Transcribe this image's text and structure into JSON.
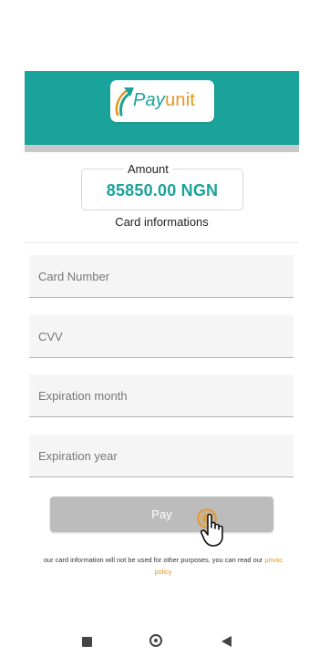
{
  "brand": {
    "logo_pay": "Pay",
    "logo_unit": "unit",
    "primary_color": "#1aa39a",
    "accent_color": "#e8951b"
  },
  "amount": {
    "label": "Amount",
    "value": "85850.00 NGN"
  },
  "card_form": {
    "title": "Card informations",
    "card_number_placeholder": "Card Number",
    "cvv_placeholder": "CVV",
    "expiration_month_placeholder": "Expiration month",
    "expiration_year_placeholder": "Expiration year",
    "pay_label": "Pay"
  },
  "notice": {
    "text": "our card information will not be used for other purposes, you can read our ",
    "link_part1": "privac",
    "link_part2": "policy"
  },
  "nav_icons": [
    "recents-square-icon",
    "home-circle-icon",
    "back-triangle-icon"
  ]
}
